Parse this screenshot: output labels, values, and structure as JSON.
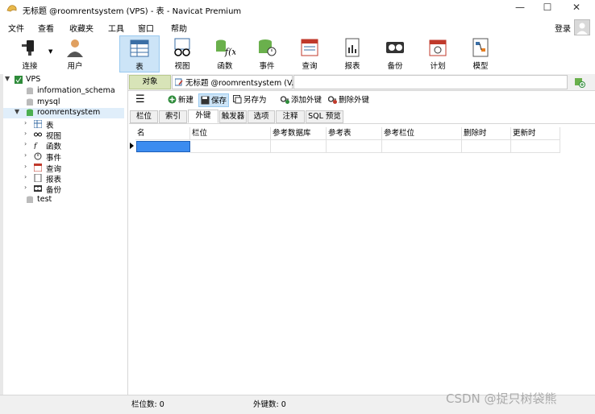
{
  "window": {
    "title": "无标题 @roomrentsystem (VPS) - 表 - Navicat Premium",
    "controls": [
      "—",
      "☐",
      "✕"
    ]
  },
  "menu": [
    "文件",
    "查看",
    "收藏夹",
    "工具",
    "窗口",
    "帮助"
  ],
  "login_label": "登录",
  "toolbar": [
    {
      "label": "连接",
      "icon": "plug-icon"
    },
    {
      "label": "用户",
      "icon": "user-icon"
    },
    {
      "label": "表",
      "icon": "table-icon",
      "active": true
    },
    {
      "label": "视图",
      "icon": "view-icon"
    },
    {
      "label": "函数",
      "icon": "function-icon"
    },
    {
      "label": "事件",
      "icon": "event-icon"
    },
    {
      "label": "查询",
      "icon": "query-icon"
    },
    {
      "label": "报表",
      "icon": "report-icon"
    },
    {
      "label": "备份",
      "icon": "backup-icon"
    },
    {
      "label": "计划",
      "icon": "calendar-icon"
    },
    {
      "label": "模型",
      "icon": "model-icon"
    }
  ],
  "tree": {
    "connection": "VPS",
    "databases": [
      "information_schema",
      "mysql",
      "roomrentsystem",
      "test"
    ],
    "children": [
      "表",
      "视图",
      "函数",
      "事件",
      "查询",
      "报表",
      "备份"
    ]
  },
  "tabs": {
    "objects": "对象",
    "document": "无标题 @roomrentsystem (V..."
  },
  "object_toolbar": {
    "new": "新建",
    "save": "保存",
    "save_as": "另存为",
    "add_fk": "添加外键",
    "delete_fk": "删除外键"
  },
  "designer_tabs": [
    "栏位",
    "索引",
    "外键",
    "触发器",
    "选项",
    "注释",
    "SQL 预览"
  ],
  "grid": {
    "columns": [
      "名",
      "栏位",
      "参考数据库",
      "参考表",
      "参考栏位",
      "删除时",
      "更新时"
    ]
  },
  "status": {
    "field_count": "栏位数: 0",
    "fk_count": "外键数: 0"
  },
  "watermark": "CSDN @捉只树袋熊",
  "colors": {
    "accent": "#cce4f7",
    "selected_cell": "#3c8cf0",
    "objects_tab": "#d8e4b8"
  }
}
